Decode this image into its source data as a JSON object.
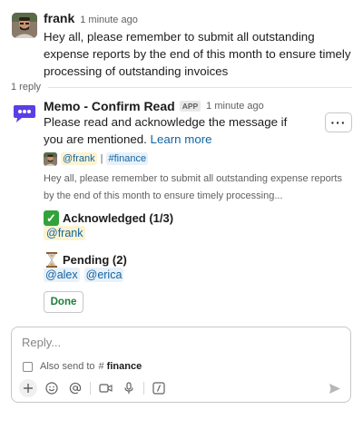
{
  "message1": {
    "author": "frank",
    "time": "1 minute ago",
    "text": "Hey all, please remember to submit all outstanding expense reports by the end of this month to ensure timely processing of outstanding invoices"
  },
  "thread": {
    "reply_count": "1 reply"
  },
  "message2": {
    "author": "Memo - Confirm Read",
    "badge": "APP",
    "time": "1 minute ago",
    "intro": "Please read and acknowledge the message if you are mentioned.",
    "link": "Learn more",
    "more_label": "···",
    "context": {
      "author_mention": "@frank",
      "separator": "|",
      "channel_mention": "#finance"
    },
    "preview": "Hey all, please remember to submit all outstanding expense reports by the end of this month to ensure timely processing...",
    "acknowledged": {
      "title": "Acknowledged (1/3)",
      "icon": "check-mark-icon",
      "users": [
        "@frank"
      ]
    },
    "pending": {
      "title": "Pending (2)",
      "icon": "hourglass-icon",
      "users": [
        "@alex",
        "@erica"
      ]
    },
    "done_label": "Done"
  },
  "composer": {
    "placeholder": "Reply...",
    "also_send_label": "Also send to",
    "channel_hash": "#",
    "channel_name": "finance"
  },
  "colors": {
    "link": "#1264a3",
    "done_text": "#1a7f37",
    "check_green": "#32a33a",
    "app_icon_purple": "#5b3ee6"
  }
}
